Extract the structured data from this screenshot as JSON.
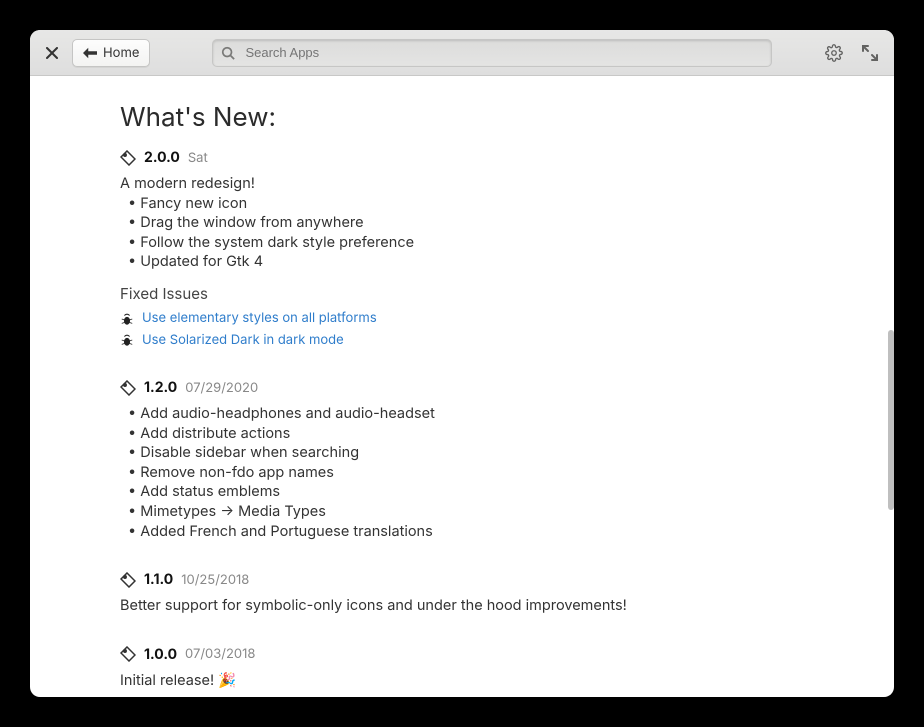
{
  "toolbar": {
    "home_label": "Home",
    "search_placeholder": "Search Apps"
  },
  "page": {
    "title": "What's New:",
    "fixed_issues_label": "Fixed Issues"
  },
  "releases": [
    {
      "version": "2.0.0",
      "date": "Sat",
      "intro": "A modern redesign!",
      "bullets": [
        "Fancy new icon",
        "Drag the window from anywhere",
        "Follow the system dark style preference",
        "Updated for Gtk 4"
      ],
      "issues": [
        "Use elementary styles on all platforms",
        "Use Solarized Dark in dark mode"
      ]
    },
    {
      "version": "1.2.0",
      "date": "07/29/2020",
      "bullets": [
        "Add audio-headphones and audio-headset",
        "Add distribute actions",
        "Disable sidebar when searching",
        "Remove non-fdo app names",
        "Add status emblems",
        "Mimetypes → Media Types",
        "Added French and Portuguese translations"
      ]
    },
    {
      "version": "1.1.0",
      "date": "10/25/2018",
      "intro": "Better support for symbolic-only icons and under the hood improvements!"
    },
    {
      "version": "1.0.0",
      "date": "07/03/2018",
      "intro": "Initial release! 🎉"
    }
  ]
}
